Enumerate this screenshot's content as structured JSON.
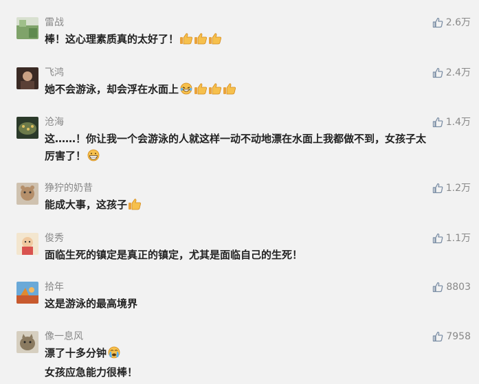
{
  "comments": [
    {
      "name": "雷战",
      "lines": [
        "棒！这心理素质真的太好了！"
      ],
      "emojis": [
        "thumbs-up",
        "thumbs-up",
        "thumbs-up"
      ],
      "likes": "2.6万"
    },
    {
      "name": "飞鸿",
      "lines": [
        "她不会游泳，却会浮在水面上"
      ],
      "emojis": [
        "laughing-face",
        "thumbs-up",
        "thumbs-up",
        "thumbs-up"
      ],
      "likes": "2.4万"
    },
    {
      "name": "沧海",
      "lines": [
        "这……！你让我一个会游泳的人就这样一动不动地漂在水面上我都做不到，女孩子太",
        "厉害了！"
      ],
      "emojis": [
        "grinning-face"
      ],
      "likes": "1.4万"
    },
    {
      "name": "狰狞的奶昔",
      "lines": [
        "能成大事，这孩子"
      ],
      "emojis": [
        "thumbs-up"
      ],
      "likes": "1.2万"
    },
    {
      "name": "俊秀",
      "lines": [
        "面临生死的镇定是真正的镇定，尤其是面临自己的生死！"
      ],
      "emojis": [],
      "likes": "1.1万"
    },
    {
      "name": "拾年",
      "lines": [
        "这是游泳的最高境界"
      ],
      "emojis": [],
      "likes": "8803"
    },
    {
      "name": "像一息风",
      "lines": [
        "漂了十多分钟",
        "女孩应急能力很棒！"
      ],
      "emojis": [
        "crying-face"
      ],
      "likes": "7958"
    }
  ],
  "avatar_colors": [
    "#7fa36a",
    "#5a4036",
    "#3c5a3a",
    "#b58f6a",
    "#d9b48f",
    "#c85a2e",
    "#8a7a60"
  ]
}
